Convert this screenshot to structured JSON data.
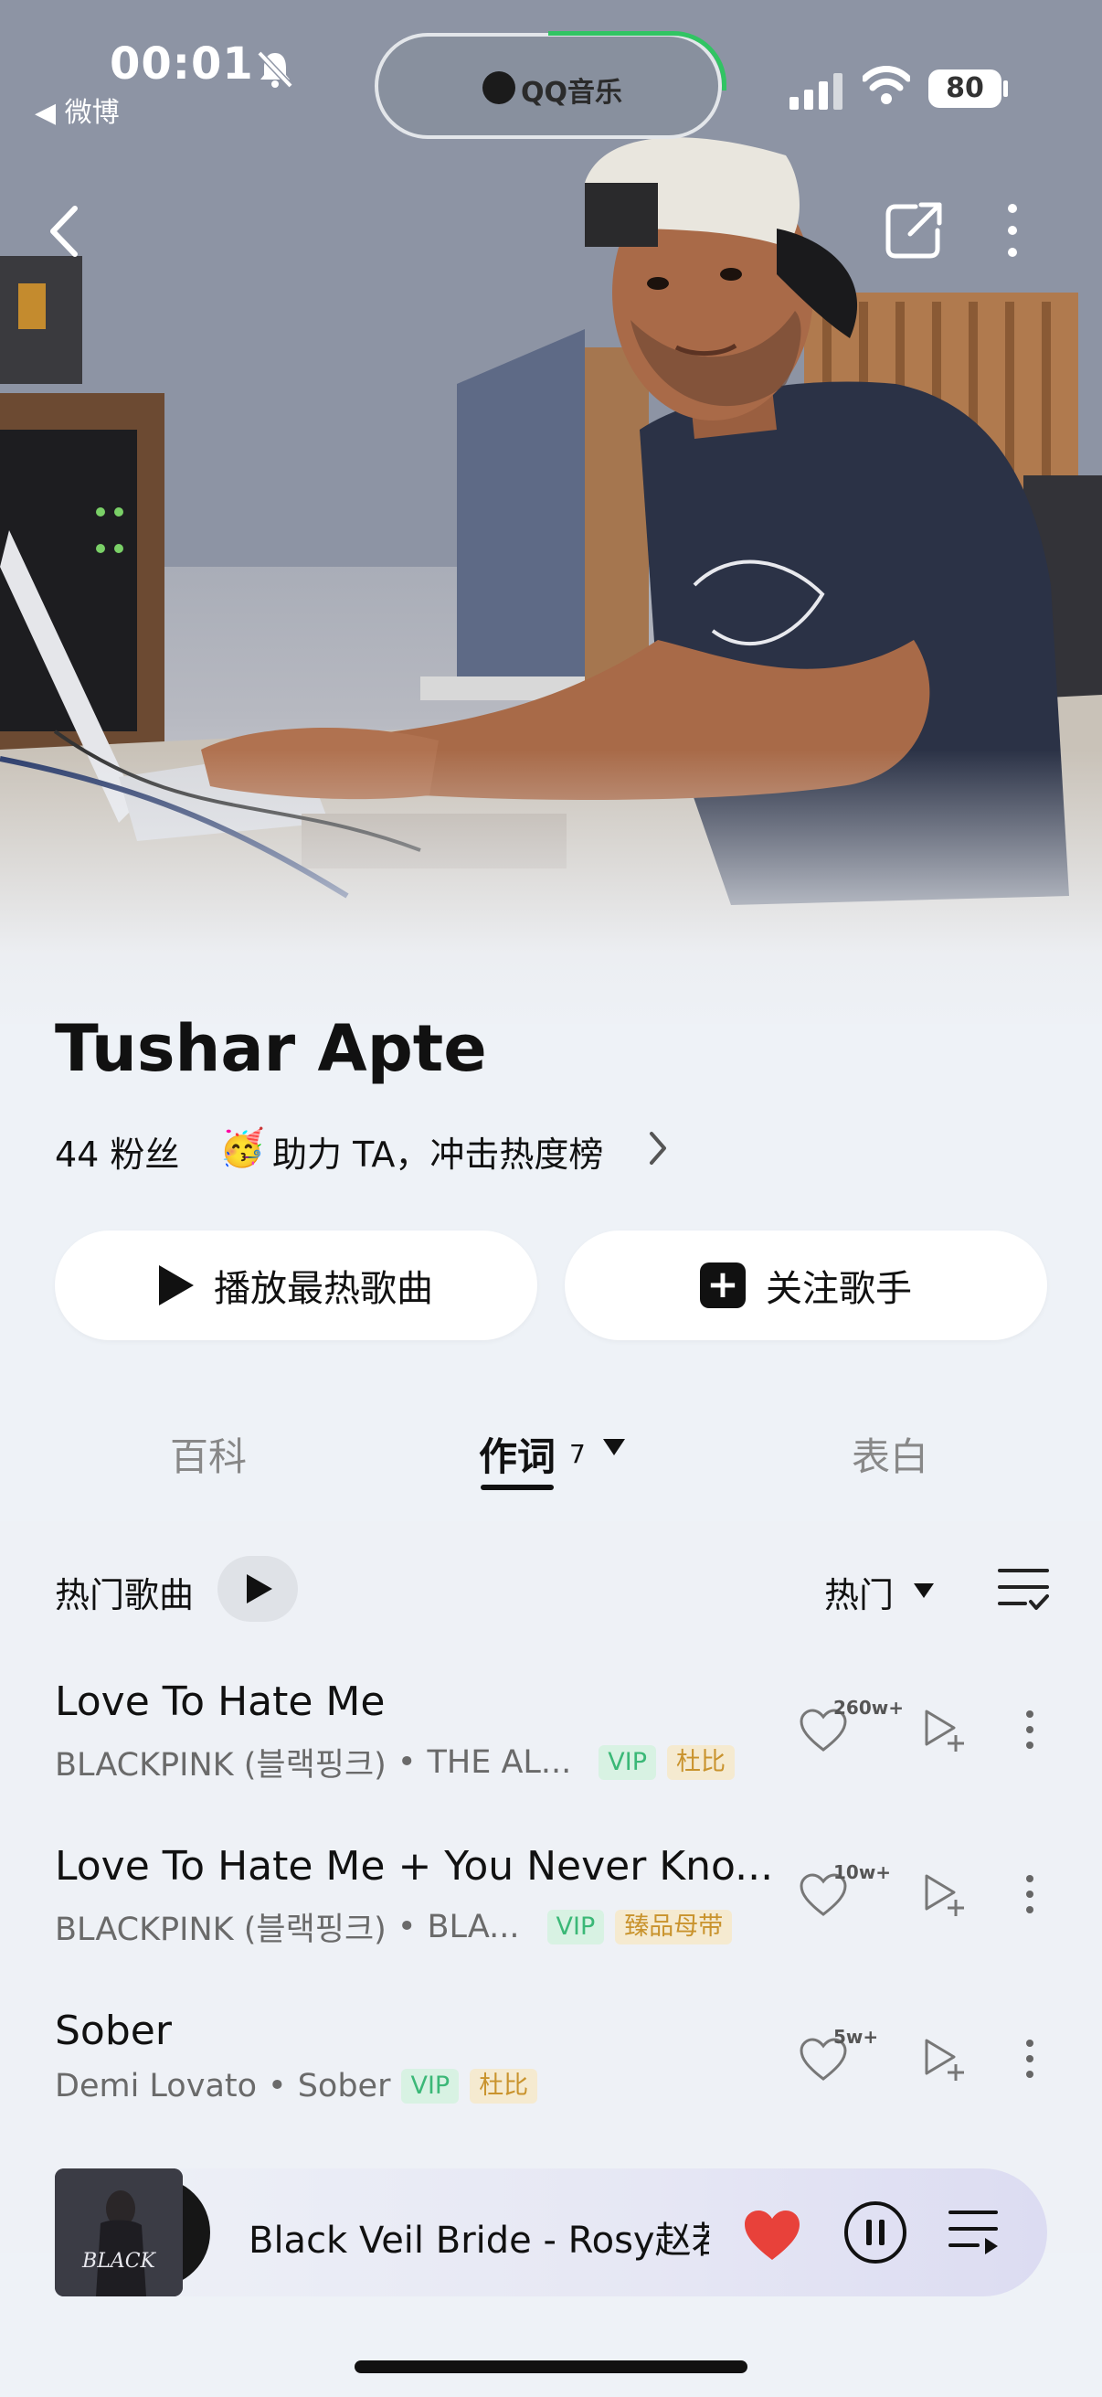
{
  "status_bar": {
    "time": "00:01",
    "back_app": "◀ 微博",
    "island_app": "QQ音乐",
    "battery": "80"
  },
  "artist": {
    "name": "Tushar Apte",
    "fans": "44 粉丝",
    "boost_emoji": "🥳",
    "boost_text": "助力 TA，冲击热度榜"
  },
  "actions": {
    "play_hot": "播放最热歌曲",
    "follow": "关注歌手"
  },
  "tabs": [
    {
      "label": "百科"
    },
    {
      "label": "作词",
      "count": "7",
      "active": true
    },
    {
      "label": "表白"
    }
  ],
  "hot_songs": {
    "title": "热门歌曲",
    "sort": "热门"
  },
  "songs": [
    {
      "title": "Love To Hate Me",
      "artist": "BLACKPINK (블랙핑크)",
      "album": "THE AL...",
      "tags": [
        "VIP",
        "杜比"
      ],
      "likes": "260w+"
    },
    {
      "title": "Love To Hate Me + You Never Kno...",
      "artist": "BLACKPINK (블랙핑크)",
      "album": "BLA...",
      "tags": [
        "VIP",
        "臻品母带"
      ],
      "likes": "10w+"
    },
    {
      "title": "Sober",
      "artist": "Demi Lovato",
      "album": "Sober",
      "tags": [
        "VIP",
        "杜比"
      ],
      "likes": "5w+"
    }
  ],
  "player": {
    "now_playing": "Black Veil Bride - Rosy赵若",
    "cover_text": "BLACK"
  },
  "colors": {
    "accent_green": "#31c463",
    "vip_green": "#3bb877",
    "quality_gold": "#c9932d",
    "heart_red": "#e8413a"
  }
}
